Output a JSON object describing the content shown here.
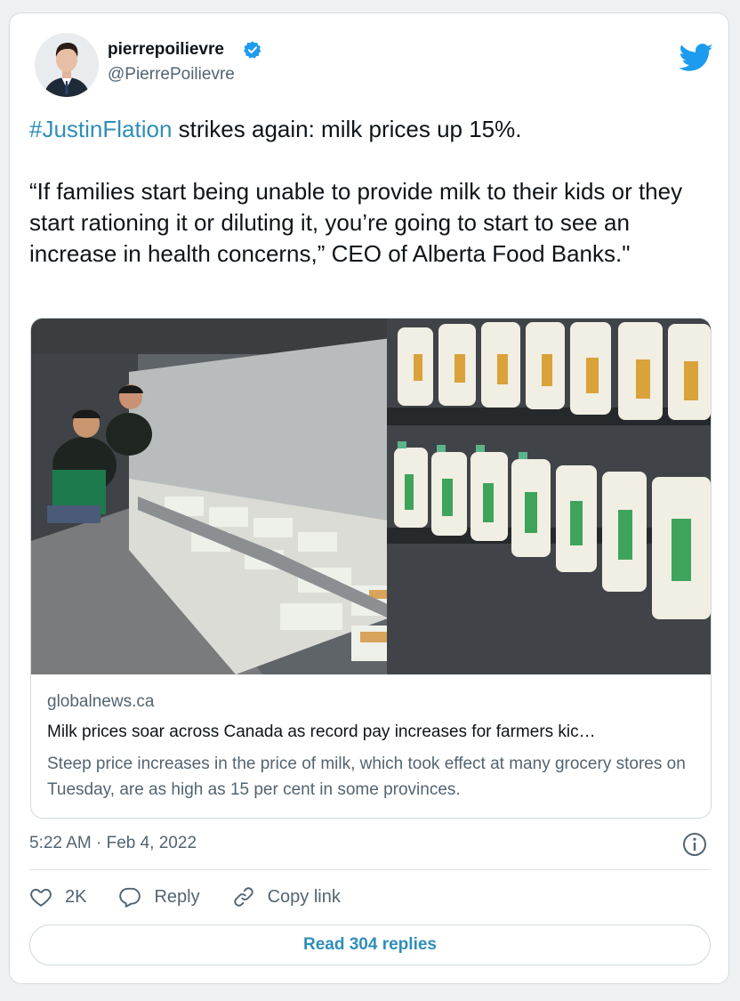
{
  "tweet": {
    "display_name": "pierrepoilievre",
    "handle": "@PierrePoilievre",
    "hashtag": "#JustinFlation",
    "text_line1_rest": " strikes again: milk prices up 15%.",
    "quote": "“If families start being unable to provide milk to their kids or they start rationing it or diluting it, you’re going to start to see an increase in health concerns,” CEO of Alberta Food Banks.\"",
    "timestamp": "5:22 AM · Feb 4, 2022"
  },
  "link_card": {
    "domain": "globalnews.ca",
    "headline": "Milk prices soar across Canada as record pay increases for farmers kic…",
    "description": "Steep price increases in the price of milk, which took effect at many grocery stores on Tuesday, are as high as 15 per cent in some provinces."
  },
  "actions": {
    "like_count": "2K",
    "reply_label": "Reply",
    "copy_link_label": "Copy link"
  },
  "read_replies_label": "Read 304 replies",
  "colors": {
    "accent": "#2f8eb8",
    "twitter_blue": "#1d9bf0",
    "muted_text": "#536471"
  },
  "icons": [
    "verified-badge-icon",
    "twitter-bird-icon",
    "info-icon",
    "heart-icon",
    "reply-icon",
    "link-icon"
  ]
}
